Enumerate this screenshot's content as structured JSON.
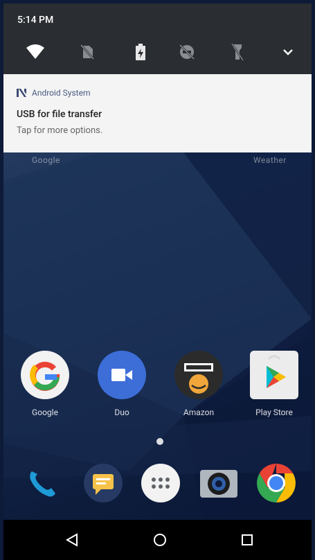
{
  "status": {
    "time": "5:14 PM"
  },
  "quick_settings": {
    "icons": [
      "wifi-icon",
      "no-sim-icon",
      "battery-icon",
      "dnd-off-icon",
      "flashlight-icon",
      "expand-icon"
    ]
  },
  "notification": {
    "app_name": "Android System",
    "title": "USB for file transfer",
    "text": "Tap for more options."
  },
  "peek": {
    "left": "Google",
    "right": "Weather"
  },
  "home": {
    "apps": [
      {
        "label": "Google"
      },
      {
        "label": "Duo"
      },
      {
        "label": "Amazon"
      },
      {
        "label": "Play Store"
      }
    ],
    "dock": [
      "phone-icon",
      "messages-icon",
      "app-drawer-icon",
      "camera-icon",
      "chrome-icon"
    ]
  },
  "navbar": {
    "buttons": [
      "back-icon",
      "home-icon",
      "recents-icon"
    ]
  },
  "colors": {
    "statusbar": "#2a2d31",
    "notification_bg": "#f4f4f4",
    "navbar": "#000000"
  }
}
